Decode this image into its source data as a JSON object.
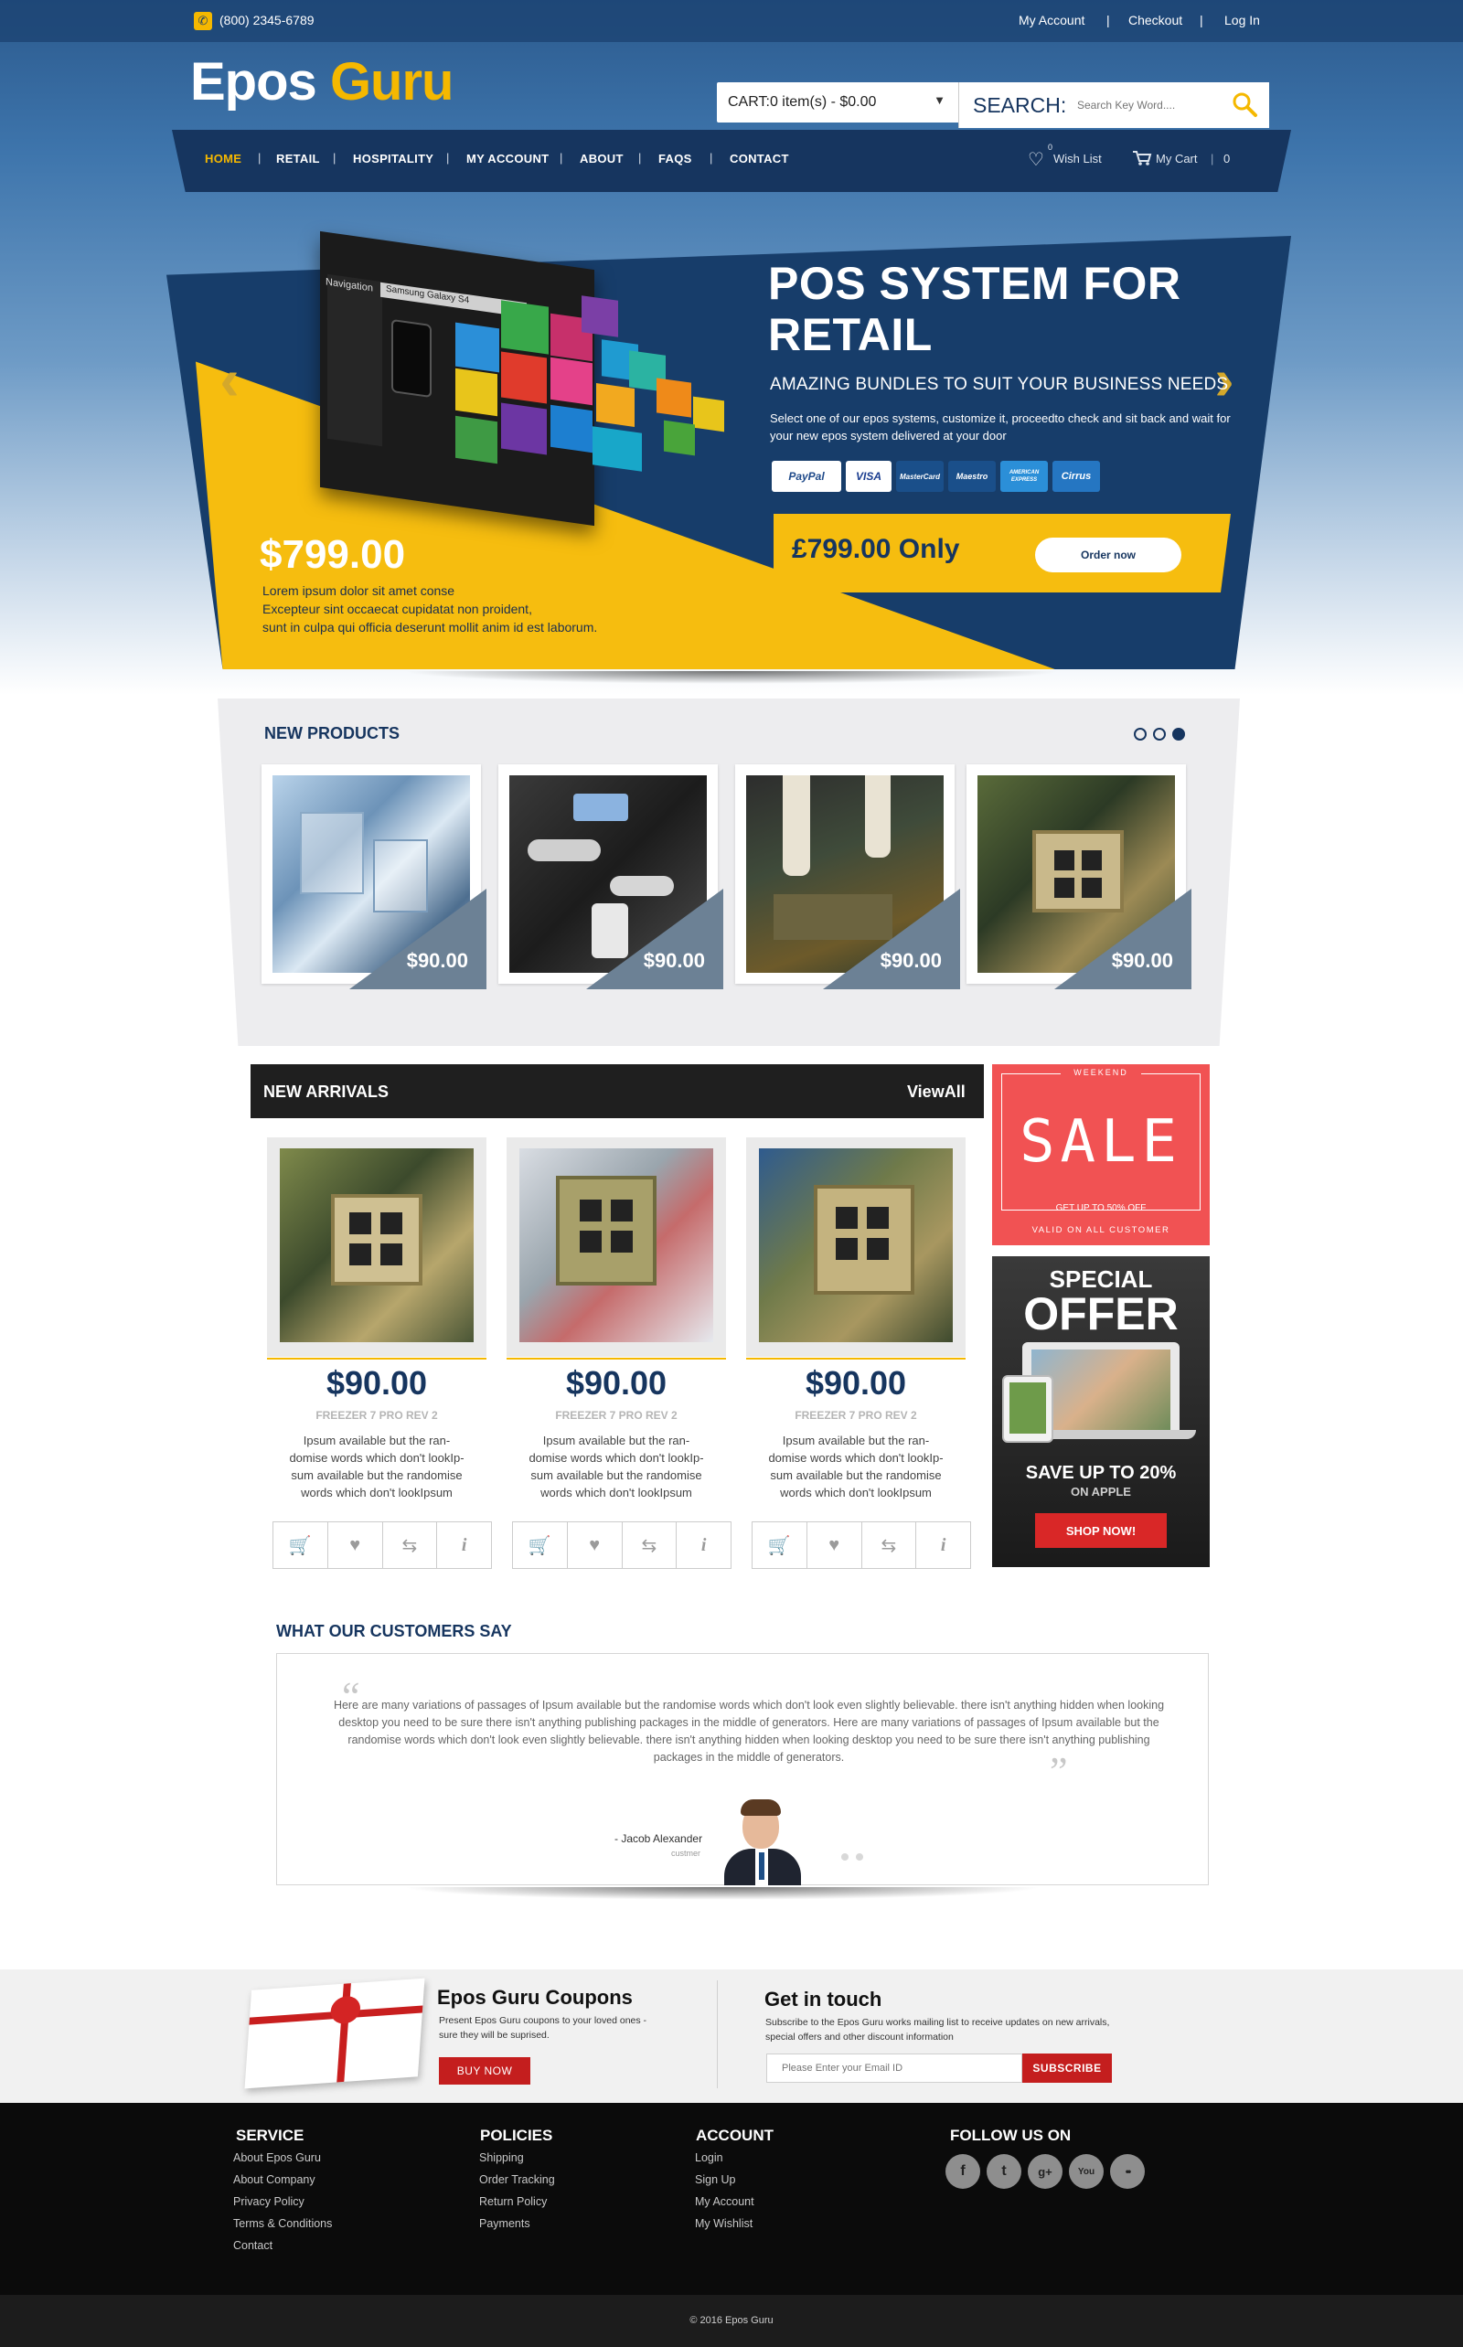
{
  "topbar": {
    "phone": "(800) 2345-6789",
    "my_account": "My Account",
    "checkout": "Checkout",
    "login": "Log In",
    "sep": "|"
  },
  "logo": {
    "part1": "Epos",
    "part2": "Guru"
  },
  "cart": {
    "label": "CART:0 item(s) - $0.00"
  },
  "search": {
    "label": "SEARCH:",
    "placeholder": "Search Key Word...."
  },
  "nav": {
    "items": [
      "HOME",
      "RETAIL",
      "HOSPITALITY",
      "MY ACCOUNT",
      "ABOUT",
      "FAQS",
      "CONTACT"
    ],
    "wishlist": "Wish List",
    "wishlist_count": "0",
    "mycart": "My Cart",
    "mycart_count": "0",
    "active_color": "#f5b800"
  },
  "hero": {
    "title": "POS SYSTEM FOR RETAIL",
    "subtitle": "AMAZING BUNDLES TO SUIT YOUR BUSINESS NEEDS",
    "description": "Select one of our epos systems, customize it, proceedto check and sit back and wait for your new epos system  delivered at your door",
    "payment_methods": [
      "PayPal",
      "VISA",
      "MasterCard",
      "Maestro",
      "AMERICAN EXPRESS",
      "Cirrus"
    ],
    "offer_price": "£799.00 Only",
    "order_button": "Order now",
    "price": "$799.00",
    "price_text_1": "Lorem ipsum dolor sit amet conse",
    "price_text_2": "Excepteur sint occaecat cupidatat non proident,",
    "price_text_3": "sunt in culpa qui officia deserunt mollit anim id est laborum.",
    "screen_nav_label": "Navigation",
    "screen_device": "Samsung Galaxy S4",
    "colors": {
      "navy": "#173d6a",
      "yellow": "#f6bd0f"
    }
  },
  "new_products": {
    "title": "NEW PRODUCTS",
    "items": [
      {
        "price": "$90.00"
      },
      {
        "price": "$90.00"
      },
      {
        "price": "$90.00"
      },
      {
        "price": "$90.00"
      }
    ]
  },
  "new_arrivals": {
    "title": "NEW ARRIVALS",
    "view_all": "ViewAll",
    "items": [
      {
        "price": "$90.00",
        "name": "FREEZER 7 PRO REV 2",
        "desc": "Ipsum available but the ran- domise words which don't lookIp- sum available but the randomise words which don't lookIpsum"
      },
      {
        "price": "$90.00",
        "name": "FREEZER 7 PRO REV 2",
        "desc": "Ipsum available but the ran- domise words which don't lookIp- sum available but the randomise words which don't lookIpsum"
      },
      {
        "price": "$90.00",
        "name": "FREEZER 7 PRO REV 2",
        "desc": "Ipsum available but the ran- domise words which don't lookIp- sum available but the randomise words which don't lookIpsum"
      }
    ]
  },
  "sale_banner": {
    "weekend": "WEEKEND",
    "sale": "SALE",
    "discount": "GET UP TO 50% OFF",
    "valid": "VALID ON ALL CUSTOMER",
    "color": "#f15253"
  },
  "offer_banner": {
    "special": "SPECIAL",
    "offer": "OFFER",
    "save": "SAVE UP TO 20%",
    "on": "ON APPLE",
    "button": "SHOP NOW!"
  },
  "testimonials": {
    "title": "WHAT OUR CUSTOMERS SAY",
    "quote": "Here are many variations of passages of Ipsum available but the randomise words which don't look even slightly believable. there isn't anything hidden when looking desktop you need to be sure there isn't anything publishing packages in the middle of generators. Here are many variations of passages of Ipsum available but the randomise words which don't look even slightly believable. there isn't anything hidden when looking desktop you need to be sure there isn't anything publishing packages in the middle of generators.",
    "author": "- Jacob Alexander",
    "role": "custmer"
  },
  "coupons": {
    "title": "Epos Guru Coupons",
    "text": "Present Epos Guru coupons to your loved ones - sure they will be suprised.",
    "button": "BUY NOW"
  },
  "newsletter": {
    "title": "Get in touch",
    "text": "Subscribe to the Epos Guru works mailing list to receive updates on new arrivals, special offers and other discount information",
    "placeholder": "Please Enter your Email ID",
    "button": "SUBSCRIBE"
  },
  "footer": {
    "service": {
      "title": "SERVICE",
      "links": [
        "About Epos Guru",
        "About Company",
        "Privacy Policy",
        "Terms & Conditions",
        "Contact"
      ]
    },
    "policies": {
      "title": "POLICIES",
      "links": [
        "Shipping",
        "Order Tracking",
        "Return Policy",
        "Payments"
      ]
    },
    "account": {
      "title": "ACCOUNT",
      "links": [
        "Login",
        "Sign Up",
        "My Account",
        "My Wishlist"
      ]
    },
    "follow": {
      "title": "FOLLOW US ON",
      "icons": [
        "facebook-icon",
        "twitter-icon",
        "google-plus-icon",
        "youtube-icon",
        "flickr-icon"
      ],
      "glyphs": [
        "f",
        "t",
        "g+",
        "You",
        "••"
      ]
    },
    "copyright": "© 2016 Epos Guru"
  }
}
